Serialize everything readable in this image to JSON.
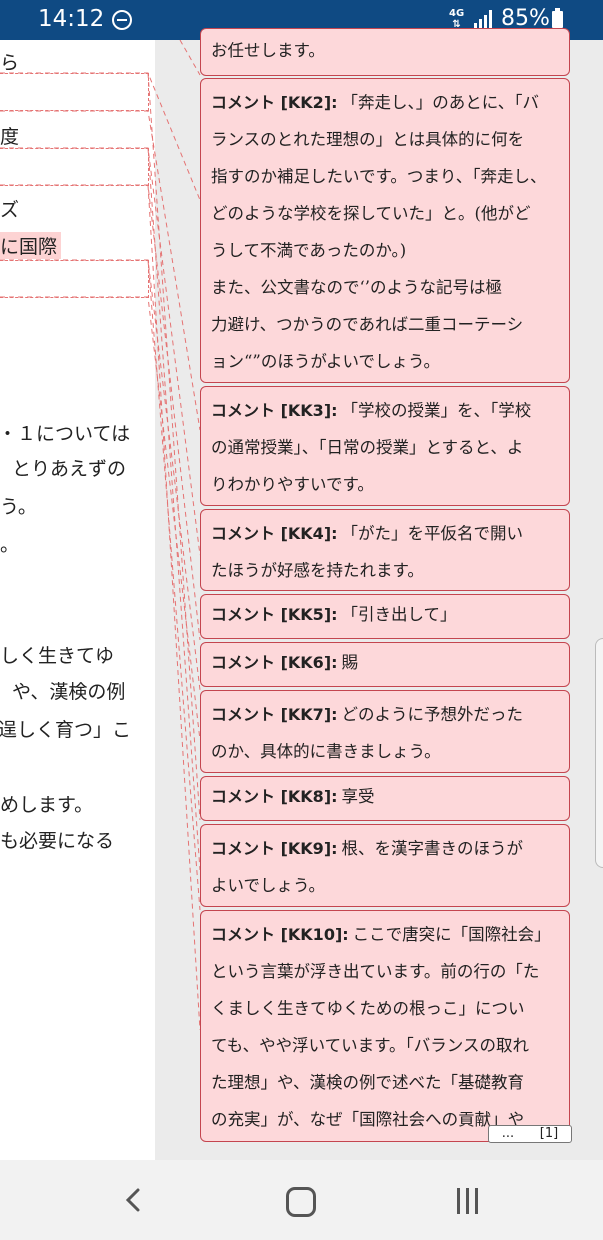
{
  "status": {
    "time": "14:12",
    "network": "4G",
    "battery": "85%"
  },
  "document": {
    "fragments": [
      "ら",
      "度",
      "ズ",
      "に国際",
      "１については",
      "とりあえずの",
      "う。",
      "。",
      "しく生きてゆ",
      "や、漢検の例",
      "逞しく育つ」こ",
      "めします。",
      "も必要になる"
    ]
  },
  "comments": [
    {
      "label": "",
      "text": "お任せします。"
    },
    {
      "label": "コメント [KK2]:",
      "text": "「奔走し、」のあとに、「バ\nランスのとれた理想の」とは具体的に何を\n指すのか補足したいです。つまり、「奔走し、\nどのような学校を探していた」と。(他がど\nうして不満であったのか。)\nまた、公文書なので‘’のような記号は極\n力避け、つかうのであれば二重コーテーシ\nョン“”のほうがよいでしょう。"
    },
    {
      "label": "コメント [KK3]:",
      "text": "「学校の授業」を、「学校\nの通常授業」、「日常の授業」とすると、よ\nりわかりやすいです。"
    },
    {
      "label": "コメント [KK4]:",
      "text": "「がた」を平仮名で開い\nたほうが好感を持たれます。"
    },
    {
      "label": "コメント [KK5]:",
      "text": "「引き出して」"
    },
    {
      "label": "コメント [KK6]:",
      "text": "賜"
    },
    {
      "label": "コメント [KK7]:",
      "text": "どのように予想外だった\nのか、具体的に書きましょう。"
    },
    {
      "label": "コメント [KK8]:",
      "text": "享受"
    },
    {
      "label": "コメント [KK9]:",
      "text": "根、を漢字書きのほうが\nよいでしょう。"
    },
    {
      "label": "コメント [KK10]:",
      "text": "ここで唐突に「国際社会」\nという言葉が浮き出ています。前の行の「た\nくましく生きてゆくための根っこ」につい\nても、やや浮いています。「バランスの取れ\nた理想」や、漢検の例で述べた「基礎教育\nの充実」が、なぜ「国際社会への貢献」や"
    }
  ],
  "more_button": {
    "dots": "...",
    "ref": "[1]"
  }
}
